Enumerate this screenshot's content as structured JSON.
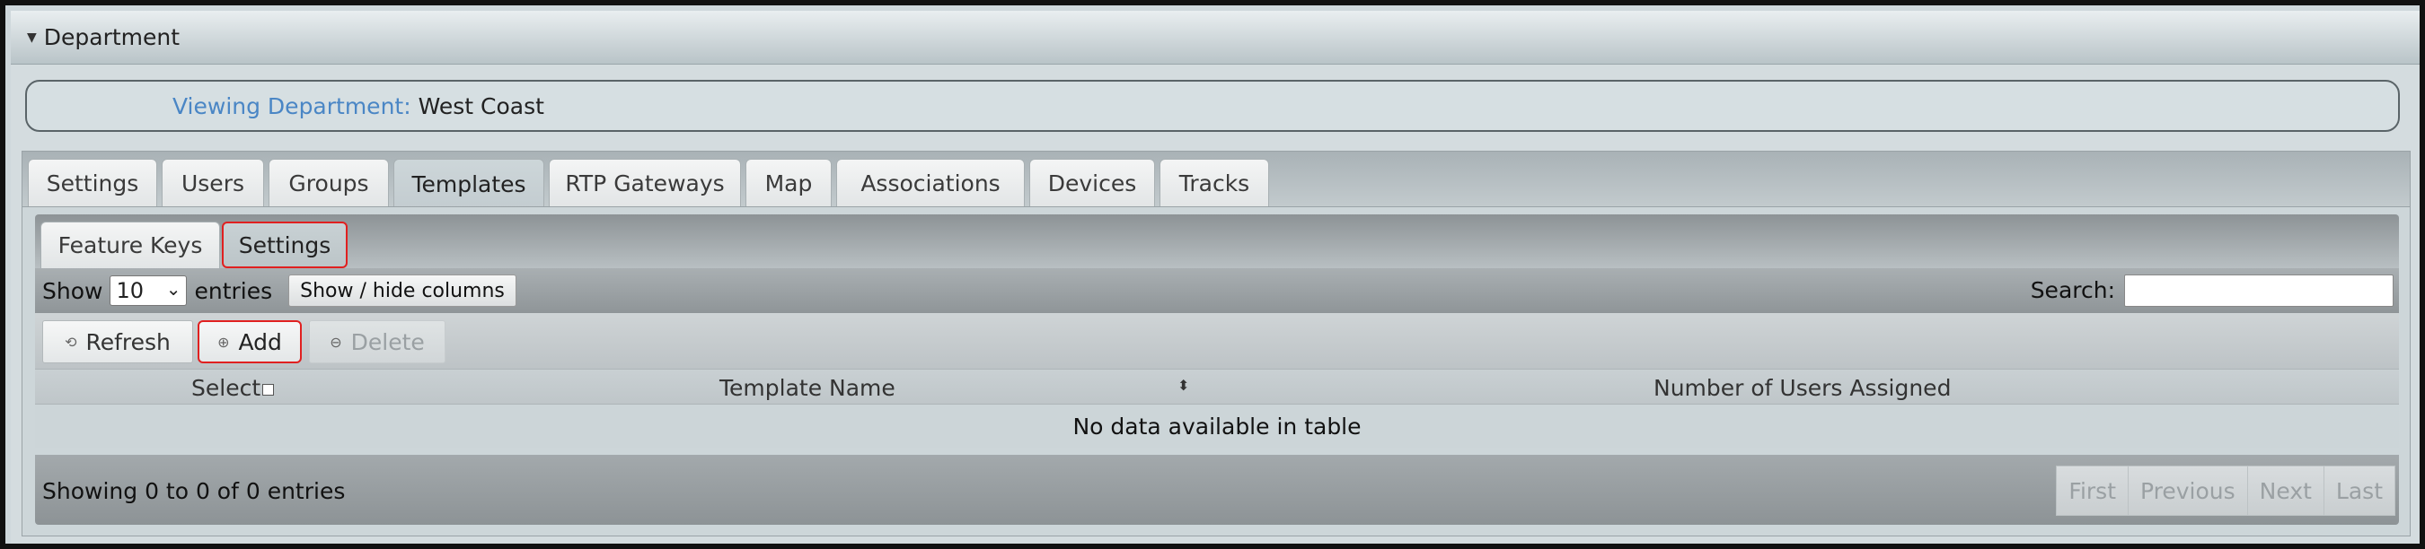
{
  "panel": {
    "title": "Department",
    "caret_icon": "triangle-down-icon"
  },
  "department": {
    "label": "Viewing Department:",
    "value": "West Coast",
    "label_color": "#4a86c5"
  },
  "tabs": [
    {
      "label": "Settings"
    },
    {
      "label": "Users"
    },
    {
      "label": "Groups"
    },
    {
      "label": "Templates",
      "active": true
    },
    {
      "label": "RTP Gateways"
    },
    {
      "label": "Map"
    },
    {
      "label": "Associations"
    },
    {
      "label": "Devices"
    },
    {
      "label": "Tracks"
    }
  ],
  "subtabs": [
    {
      "label": "Feature Keys"
    },
    {
      "label": "Settings",
      "active": true
    }
  ],
  "controls": {
    "show_label": "Show",
    "entries_value": "10",
    "entries_label": "entries",
    "show_hide_label": "Show / hide columns",
    "search_label": "Search:",
    "search_value": ""
  },
  "toolbar": {
    "refresh_label": "Refresh",
    "add_label": "Add",
    "delete_label": "Delete"
  },
  "table": {
    "columns": [
      "Select",
      "Template Name",
      "Number of Users Assigned"
    ],
    "empty_message": "No data available in table"
  },
  "footer": {
    "info": "Showing 0 to 0 of 0 entries",
    "pager": [
      "First",
      "Previous",
      "Next",
      "Last"
    ]
  },
  "colors": {
    "highlight": "#e02020"
  }
}
